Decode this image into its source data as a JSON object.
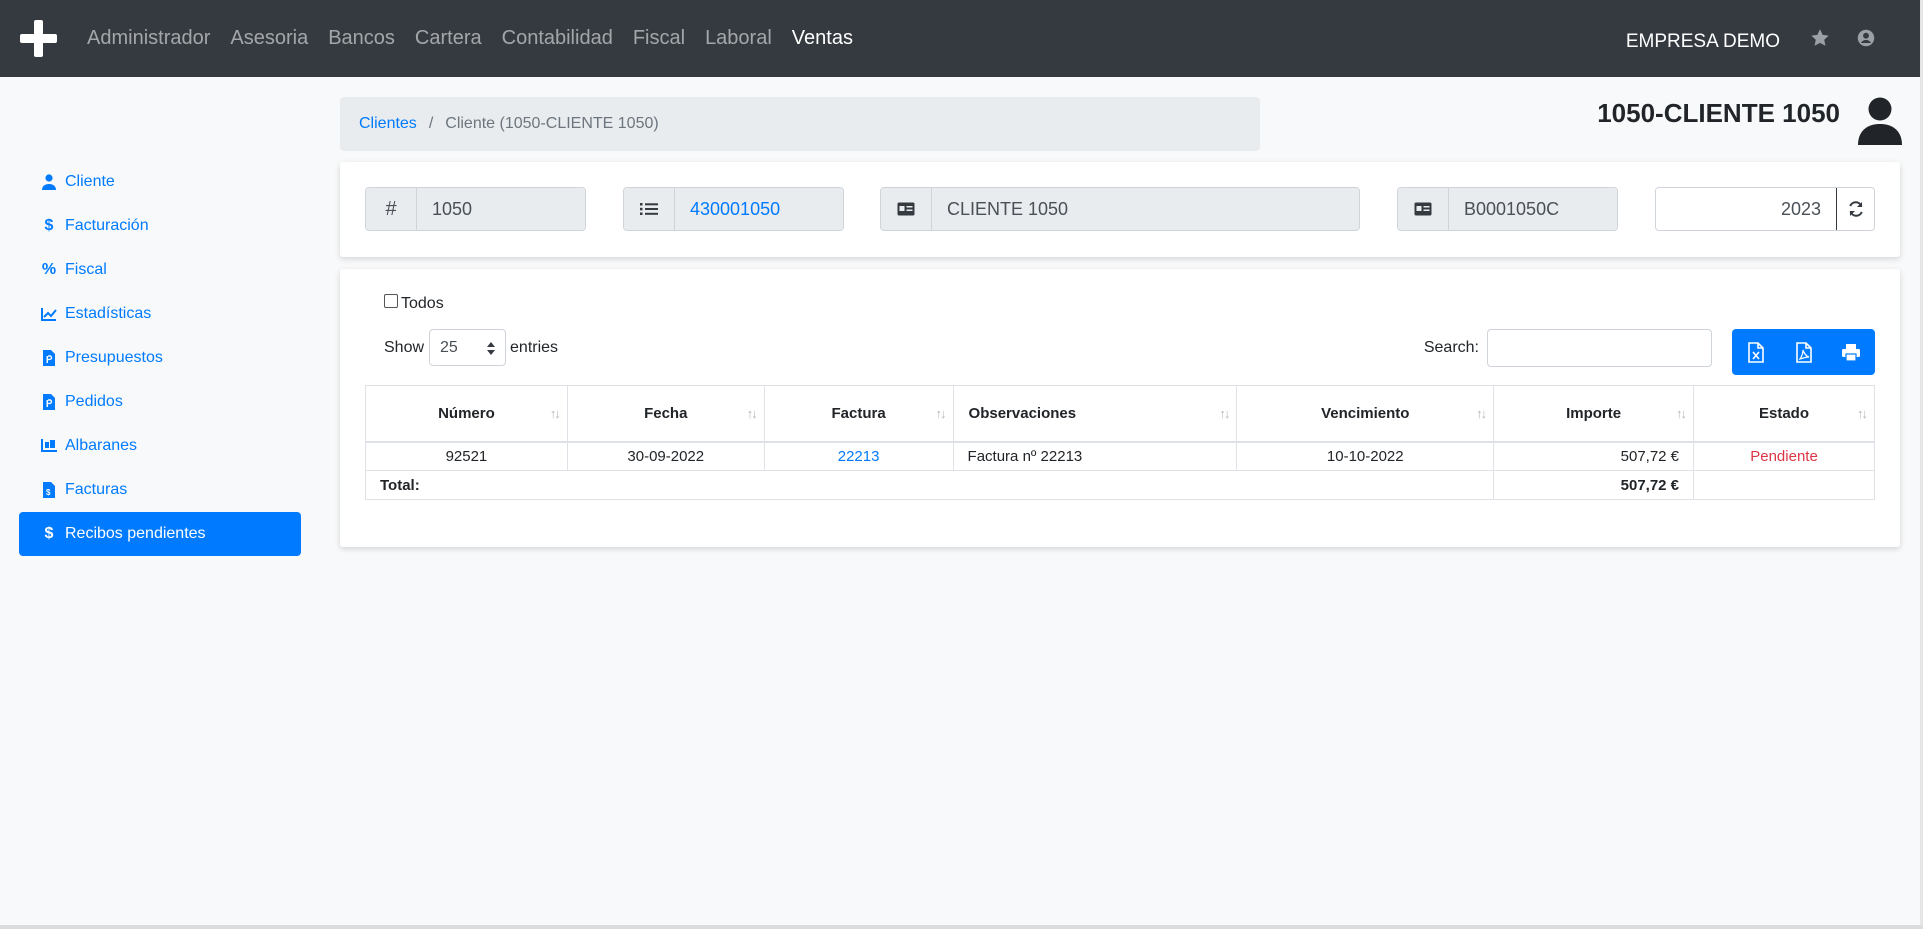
{
  "navbar": {
    "items": [
      {
        "label": "Administrador"
      },
      {
        "label": "Asesoria"
      },
      {
        "label": "Bancos"
      },
      {
        "label": "Cartera"
      },
      {
        "label": "Contabilidad"
      },
      {
        "label": "Fiscal"
      },
      {
        "label": "Laboral"
      },
      {
        "label": "Ventas"
      }
    ],
    "active": "Ventas",
    "company": "EMPRESA DEMO"
  },
  "breadcrumb": {
    "link": "Clientes",
    "separator": "/",
    "current": "Cliente (1050-CLIENTE 1050)"
  },
  "client_title": "1050-CLIENTE 1050",
  "sidebar": {
    "items": [
      {
        "label": "Cliente",
        "icon": "user-icon"
      },
      {
        "label": "Facturación",
        "icon": "dollar-icon"
      },
      {
        "label": "Fiscal",
        "icon": "percent-icon"
      },
      {
        "label": "Estadísticas",
        "icon": "chart-line-icon"
      },
      {
        "label": "Presupuestos",
        "icon": "file-p-icon"
      },
      {
        "label": "Pedidos",
        "icon": "file-p-icon"
      },
      {
        "label": "Albaranes",
        "icon": "truck-loading-icon"
      },
      {
        "label": "Facturas",
        "icon": "file-invoice-icon"
      },
      {
        "label": "Recibos pendientes",
        "icon": "dollar-icon"
      }
    ],
    "active": "Recibos pendientes"
  },
  "fields": {
    "code_addon": "#",
    "code": "1050",
    "account": "430001050",
    "name": "CLIENTE 1050",
    "cif": "B0001050C",
    "year": "2023"
  },
  "table_controls": {
    "todos_label": "Todos",
    "show_label": "Show",
    "page_size": "25",
    "entries_label": "entries",
    "search_label": "Search:",
    "search_value": ""
  },
  "table": {
    "headers": [
      "Número",
      "Fecha",
      "Factura",
      "Observaciones",
      "Vencimiento",
      "Importe",
      "Estado"
    ],
    "rows": [
      {
        "numero": "92521",
        "fecha": "30-09-2022",
        "factura": "22213",
        "observaciones": "Factura nº 22213",
        "vencimiento": "10-10-2022",
        "importe": "507,72 €",
        "estado": "Pendiente"
      }
    ],
    "total_label": "Total:",
    "total_value": "507,72 €"
  },
  "colors": {
    "primary": "#007bff",
    "navbar": "#343a40",
    "danger": "#dc3545"
  }
}
